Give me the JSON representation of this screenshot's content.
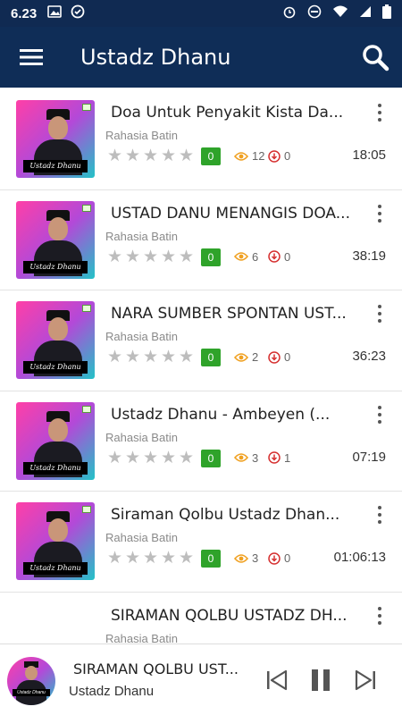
{
  "status": {
    "time": "6.23"
  },
  "app": {
    "title": "Ustadz Dhanu"
  },
  "items": [
    {
      "title": "Doa Untuk Penyakit Kista Da...",
      "subtitle": "Rahasia Batin",
      "badge": "0",
      "views": "12",
      "downloads": "0",
      "duration": "18:05",
      "thumb_caption": "Ustadz Dhanu"
    },
    {
      "title": "USTAD DANU MENANGIS DOA...",
      "subtitle": "Rahasia Batin",
      "badge": "0",
      "views": "6",
      "downloads": "0",
      "duration": "38:19",
      "thumb_caption": "Ustadz Dhanu"
    },
    {
      "title": "NARA SUMBER SPONTAN UST...",
      "subtitle": "Rahasia Batin",
      "badge": "0",
      "views": "2",
      "downloads": "0",
      "duration": "36:23",
      "thumb_caption": "Ustadz Dhanu"
    },
    {
      "title": "Ustadz Dhanu - Ambeyen  (...",
      "subtitle": "Rahasia Batin",
      "badge": "0",
      "views": "3",
      "downloads": "1",
      "duration": "07:19",
      "thumb_caption": "Ustadz Dhanu"
    },
    {
      "title": "Siraman Qolbu Ustadz Dhan...",
      "subtitle": "Rahasia Batin",
      "badge": "0",
      "views": "3",
      "downloads": "0",
      "duration": "01:06:13",
      "thumb_caption": "Ustadz Dhanu"
    },
    {
      "title": "SIRAMAN QOLBU USTADZ DH...",
      "subtitle": "Rahasia Batin"
    }
  ],
  "player": {
    "title": "SIRAMAN QOLBU UST...",
    "artist": "Ustadz Dhanu",
    "thumb_caption": "Ustadz Dhanu"
  },
  "colors": {
    "appbar": "#0f2d57",
    "badge": "#2fa32a",
    "views_icon": "#f0a020",
    "downloads_icon": "#d63030"
  }
}
